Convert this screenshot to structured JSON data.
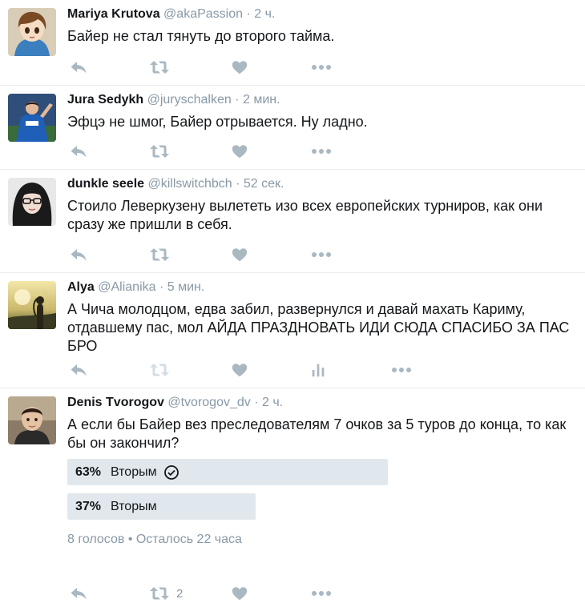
{
  "tweets": [
    {
      "fullname": "Mariya Krutova",
      "username": "@akaPassion",
      "time": "2 ч.",
      "text": "Байер не стал тянуть до второго тайма."
    },
    {
      "fullname": "Jura Sedykh",
      "username": "@juryschalken",
      "time": "2 мин.",
      "text": "Эфцэ не шмог, Байер отрывается. Ну ладно."
    },
    {
      "fullname": "dunkle seele",
      "username": "@killswitchbch",
      "time": "52 сек.",
      "text": "Стоило Леверкузену вылететь изо всех европейских турниров, как они сразу же пришли в себя."
    },
    {
      "fullname": "Alya",
      "username": "@Alianika",
      "time": "5 мин.",
      "text": "А Чича молодцом, едва забил, развернулся и давай махать Кариму, отдавшему пас, мол АЙДА ПРАЗДНОВАТЬ ИДИ СЮДА СПАСИБО ЗА ПАС БРО"
    },
    {
      "fullname": "Denis Tvorogov",
      "username": "@tvorogov_dv",
      "time": "2 ч.",
      "text": "А если бы Байер вез преследователям 7 очков за 5 туров до конца, то как бы он закончил?",
      "retweet_count": "2",
      "poll": {
        "choices": [
          {
            "percent_label": "63%",
            "percent": 63,
            "label": "Вторым",
            "selected": true
          },
          {
            "percent_label": "37%",
            "percent": 37,
            "label": "Вторым",
            "selected": false
          }
        ],
        "meta": "8 голосов • Осталось 22 часа"
      }
    }
  ],
  "separator": "·",
  "icons": {
    "reply": "reply-icon",
    "retweet": "retweet-icon",
    "like": "heart-icon",
    "more": "more-dots-icon",
    "analytics": "analytics-icon",
    "check": "check-circle-icon"
  },
  "colors": {
    "action_icon": "#aab8c2",
    "secondary_text": "#8899a6",
    "poll_bar": "#e1e8ed",
    "divider": "#e6ecf0"
  }
}
